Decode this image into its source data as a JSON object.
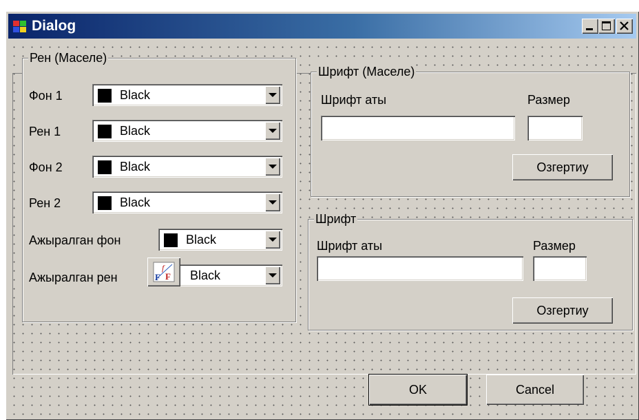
{
  "window": {
    "title": "Dialog",
    "controls": [
      "minimize-icon",
      "maximize-icon",
      "close-icon"
    ]
  },
  "color_group": {
    "title": "Рен (Маселе)",
    "rows": [
      {
        "label": "Фон 1",
        "value": "Black",
        "swatch_color": "#000000"
      },
      {
        "label": "Рен 1",
        "value": "Black",
        "swatch_color": "#000000"
      },
      {
        "label": "Фон 2",
        "value": "Black",
        "swatch_color": "#000000"
      },
      {
        "label": "Рен 2",
        "value": "Black",
        "swatch_color": "#000000"
      },
      {
        "label": "Ажыралган фон",
        "value": "Black",
        "swatch_color": "#000000"
      },
      {
        "label": "Ажыралган рен",
        "value": "Black",
        "icon": "font-color-icon"
      }
    ]
  },
  "font_group_1": {
    "title": "Шрифт (Маселе)",
    "name_label": "Шрифт аты",
    "size_label": "Размер",
    "name_value": "",
    "size_value": "",
    "change_button": "Озгертиу"
  },
  "font_group_2": {
    "title": "Шрифт",
    "name_label": "Шрифт аты",
    "size_label": "Размер",
    "name_value": "",
    "size_value": "",
    "change_button": "Озгертиу"
  },
  "buttons": {
    "ok": "OK",
    "cancel": "Cancel"
  },
  "colors": {
    "title_gradient_start": "#0a246a",
    "title_gradient_end": "#a6caf0",
    "face": "#d4d0c8"
  }
}
